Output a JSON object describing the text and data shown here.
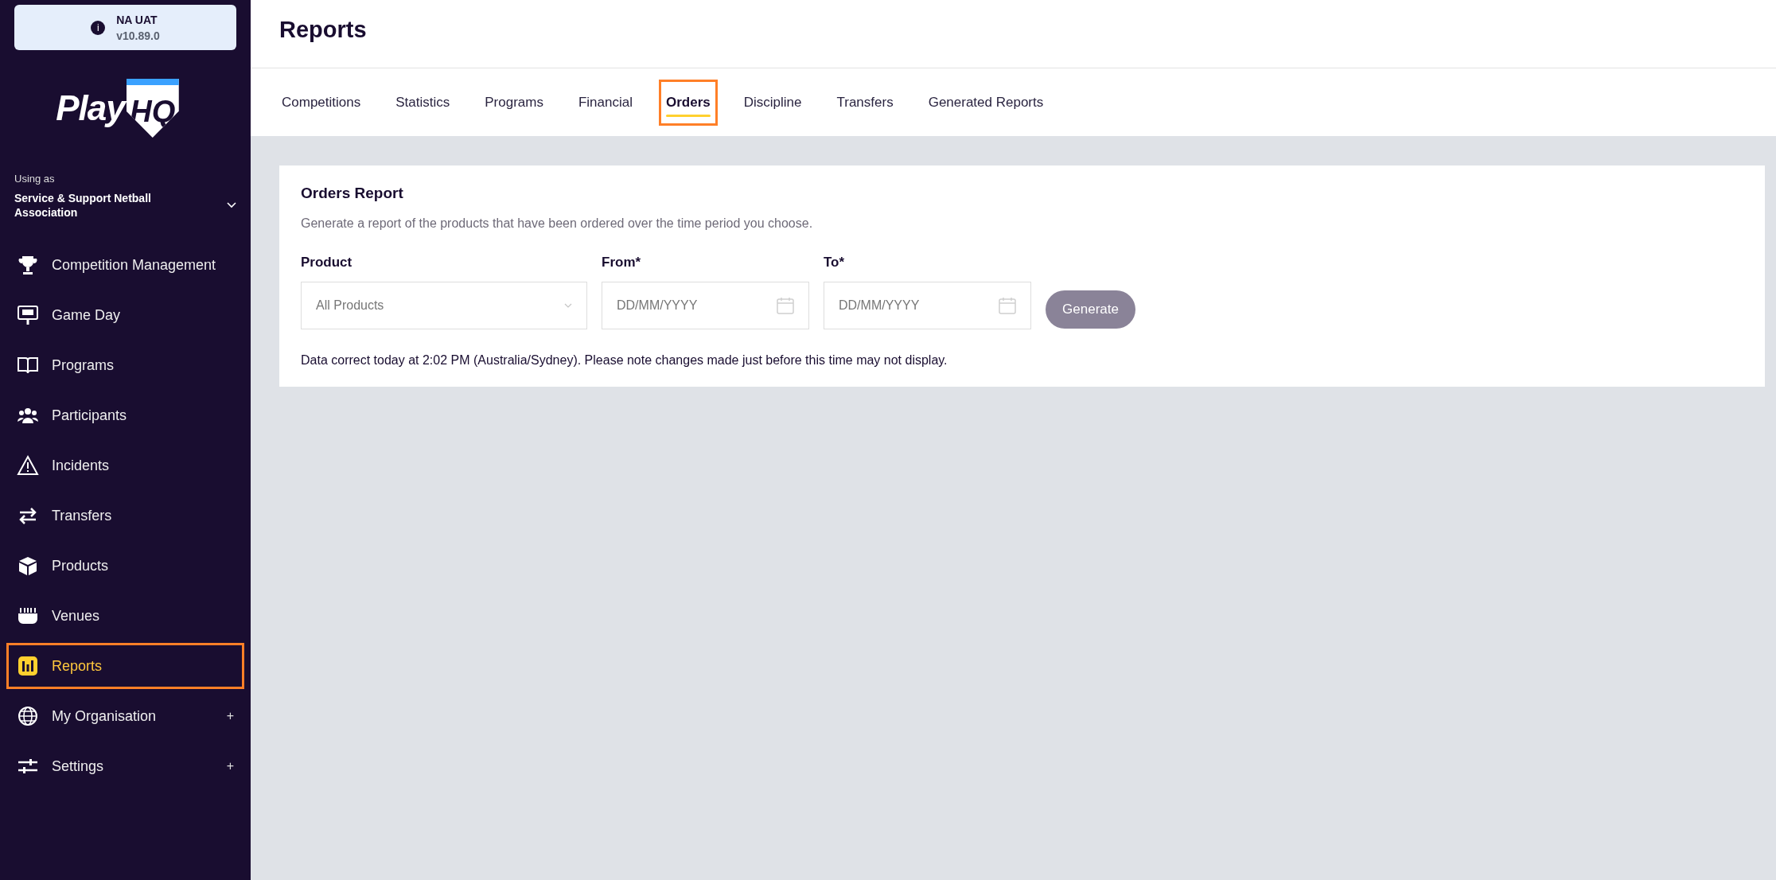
{
  "env_badge": {
    "icon": "i",
    "name": "NA UAT",
    "version": "v10.89.0"
  },
  "logo": {
    "left": "Play",
    "right": "HQ"
  },
  "account": {
    "label": "Using as",
    "name": "Service & Support Netball Association"
  },
  "nav": [
    {
      "label": "Competition Management",
      "selected": false
    },
    {
      "label": "Game Day",
      "selected": false
    },
    {
      "label": "Programs",
      "selected": false
    },
    {
      "label": "Participants",
      "selected": false
    },
    {
      "label": "Incidents",
      "selected": false
    },
    {
      "label": "Transfers",
      "selected": false
    },
    {
      "label": "Products",
      "selected": false
    },
    {
      "label": "Venues",
      "selected": false
    },
    {
      "label": "Reports",
      "selected": true
    },
    {
      "label": "My Organisation",
      "selected": false,
      "toggle": "+"
    },
    {
      "label": "Settings",
      "selected": false,
      "toggle": "+"
    }
  ],
  "page_title": "Reports",
  "tabs": [
    {
      "label": "Competitions",
      "selected": false
    },
    {
      "label": "Statistics",
      "selected": false
    },
    {
      "label": "Programs",
      "selected": false
    },
    {
      "label": "Financial",
      "selected": false
    },
    {
      "label": "Orders",
      "selected": true
    },
    {
      "label": "Discipline",
      "selected": false
    },
    {
      "label": "Transfers",
      "selected": false
    },
    {
      "label": "Generated Reports",
      "selected": false
    }
  ],
  "report": {
    "title": "Orders Report",
    "description": "Generate a report of the products that have been ordered over the time period you choose.",
    "product": {
      "label": "Product",
      "value": "All Products"
    },
    "from": {
      "label": "From*",
      "placeholder": "DD/MM/YYYY"
    },
    "to": {
      "label": "To*",
      "placeholder": "DD/MM/YYYY"
    },
    "button": "Generate",
    "note": "Data correct today at 2:02 PM (Australia/Sydney). Please note changes made just before this time may not display."
  }
}
